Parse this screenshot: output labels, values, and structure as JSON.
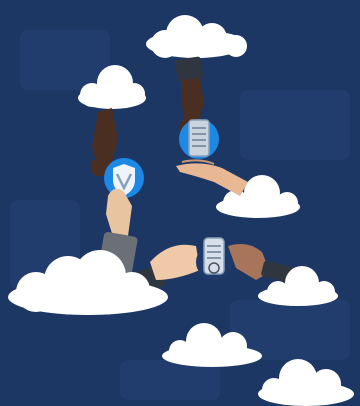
{
  "scene": {
    "background": "#1d3765",
    "background_accent": "#2b4a80",
    "cloud_color": "#ffffff",
    "badge_color": "#1e88e5",
    "device_color": "#8aa0b8",
    "sleeve_dark": "#2f3640",
    "sleeve_grey": "#6b6f76",
    "skin_dark": "#4a2e22",
    "skin_medium": "#a9755a",
    "skin_light": "#f0c9a8"
  }
}
